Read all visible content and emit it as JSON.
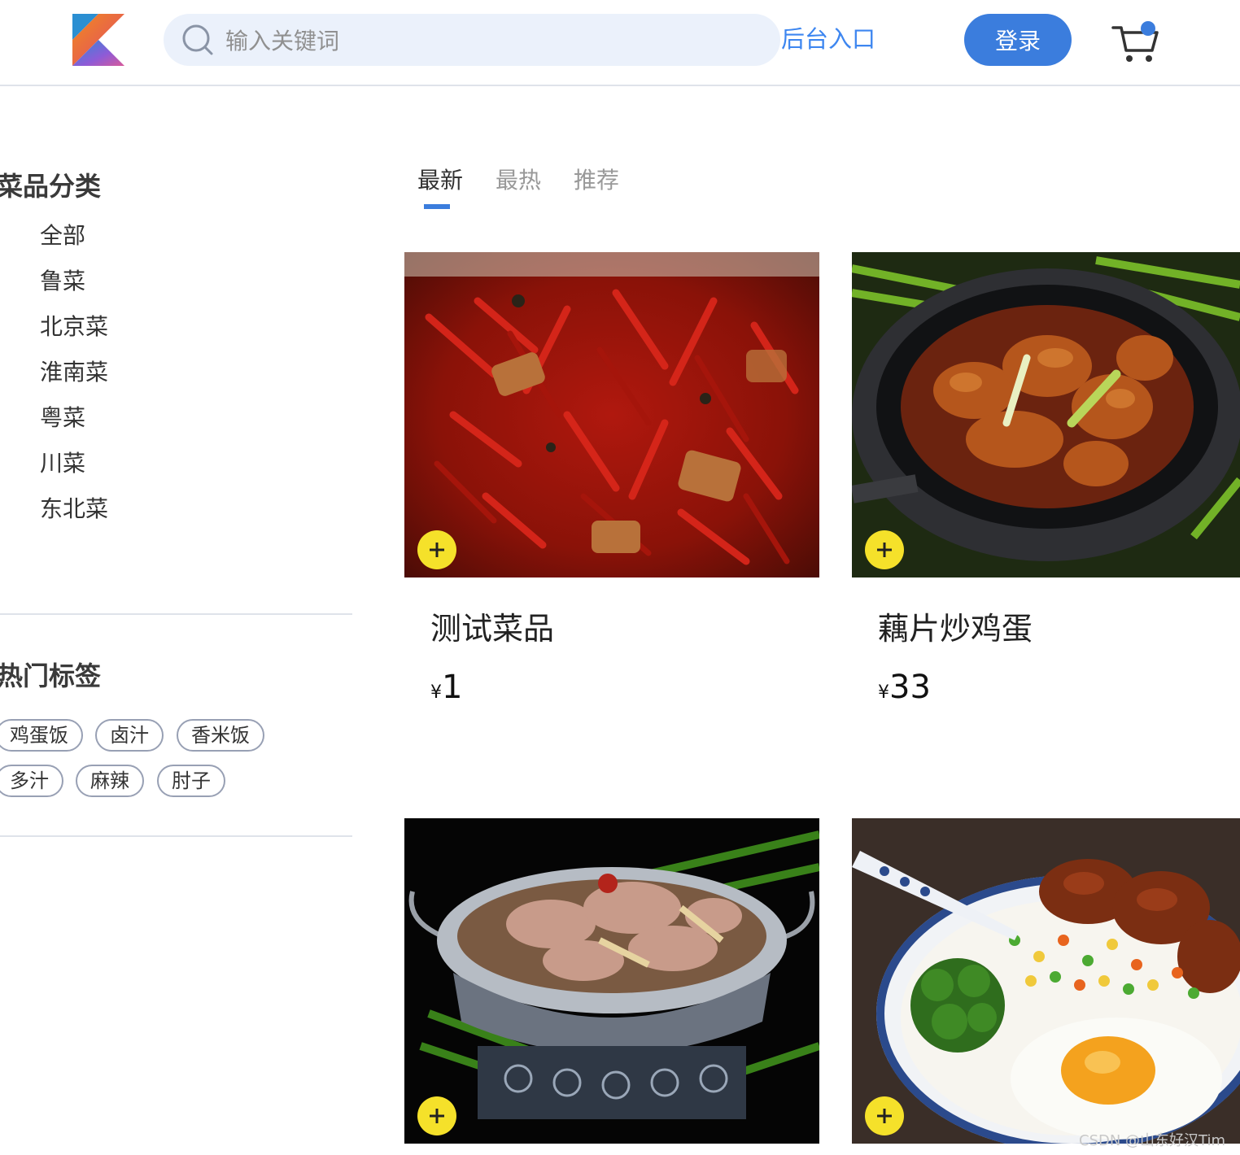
{
  "header": {
    "search_placeholder": "输入关键词",
    "admin_link": "后台入口",
    "login_label": "登录"
  },
  "sidebar": {
    "categories_title": "菜品分类",
    "categories": [
      "全部",
      "鲁菜",
      "北京菜",
      "淮南菜",
      "粤菜",
      "川菜",
      "东北菜"
    ],
    "tags_title": "热门标签",
    "tags": [
      "鸡蛋饭",
      "卤汁",
      "香米饭",
      "多汁",
      "麻辣",
      "肘子"
    ]
  },
  "tabs": [
    "最新",
    "最热",
    "推荐"
  ],
  "active_tab": "最新",
  "products": [
    {
      "name": "测试菜品",
      "currency": "¥",
      "price": "1"
    },
    {
      "name": "藕片炒鸡蛋",
      "currency": "¥",
      "price": "33"
    },
    {
      "name": "",
      "currency": "",
      "price": ""
    },
    {
      "name": "",
      "currency": "",
      "price": ""
    }
  ],
  "watermark": "CSDN @山东好汉Tim",
  "colors": {
    "accent": "#3b7ddd",
    "link": "#3d86f0",
    "add_button": "#f5e12a"
  },
  "icons": {
    "logo": "kotlin-logo",
    "search": "search-icon",
    "cart": "cart-icon",
    "add": "plus-icon"
  }
}
